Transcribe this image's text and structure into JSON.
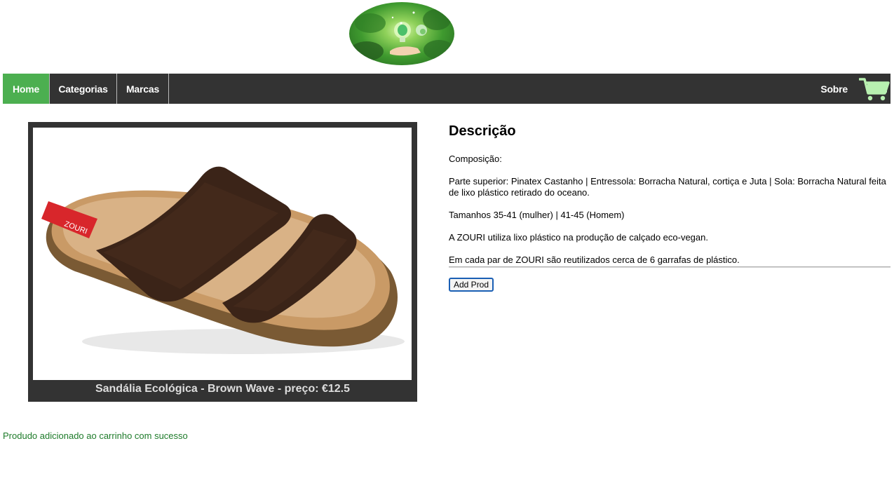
{
  "header": {
    "logo_icon": "eco-lightbulb-hand-logo"
  },
  "nav": {
    "home": "Home",
    "categorias": "Categorias",
    "marcas": "Marcas",
    "sobre": "Sobre",
    "cart_icon": "shopping-cart-icon",
    "active_color": "#4caf50",
    "bar_color": "#333333",
    "cart_color": "#b8f0b0"
  },
  "product": {
    "caption": "Sandália Ecológica - Brown Wave - preço: €12.5",
    "image_icon": "sandal-product-image"
  },
  "description": {
    "title": "Descrição",
    "composition_label": "Composição:",
    "composition": "Parte superior: Pinatex Castanho | Entressola: Borracha Natural, cortiça e Juta | Sola: Borracha Natural feita de lixo plástico retirado do oceano.",
    "sizes": "Tamanhos 35-41 (mulher) | 41-45 (Homem)",
    "info1": "A ZOURI utiliza lixo plástico na produção de calçado eco-vegan.",
    "info2": "Em cada par de ZOURI são reutilizados cerca de 6 garrafas de plástico.",
    "add_button": "Add Prod"
  },
  "status": {
    "message": "Produdo adicionado ao carrinho com sucesso",
    "color": "#1e7b2a"
  }
}
